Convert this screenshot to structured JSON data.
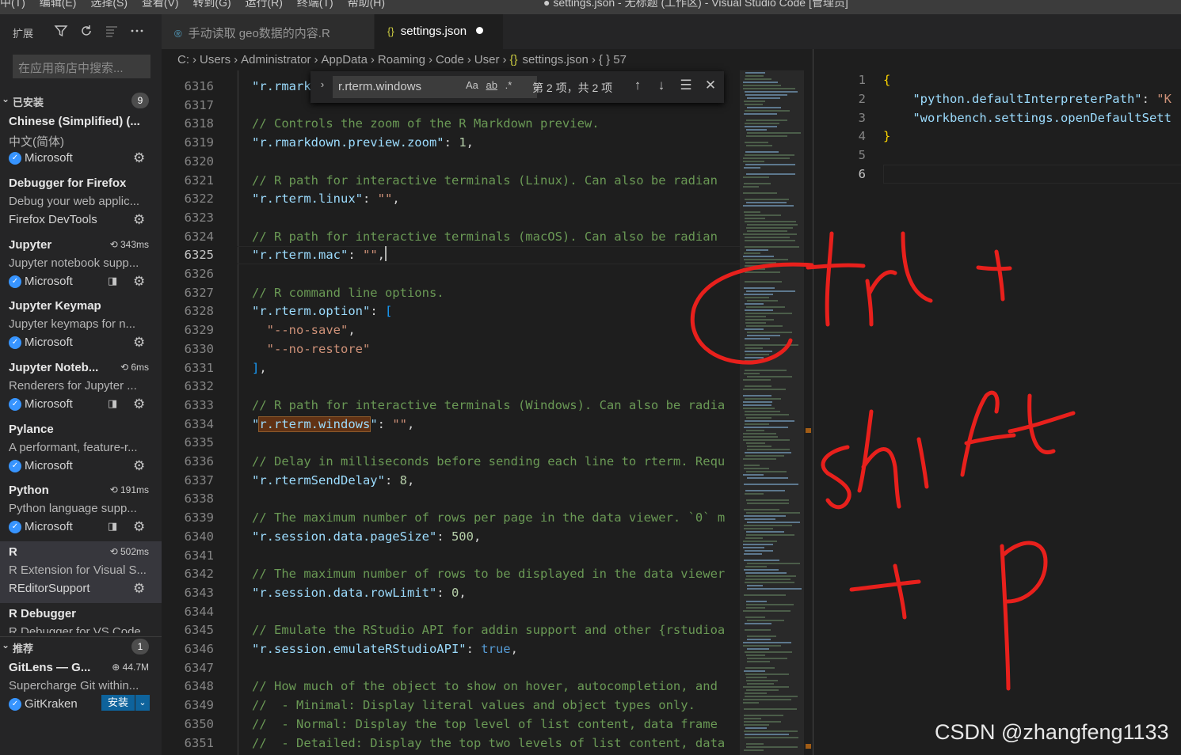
{
  "menubar": {
    "menus": "中(T)  编辑(E)  选择(S)  查看(V)  转到(G)  运行(R)  终端(T)  帮助(H)",
    "window_title": "● settings.json - 无标题 (工作区) - Visual Studio Code [管理员]"
  },
  "sidebar": {
    "title": "扩展",
    "search_placeholder": "在应用商店中搜索...",
    "installed": {
      "label": "已安装",
      "count": "9",
      "items": [
        {
          "name": "Chinese (Simplified) (...",
          "desc": "中文(简体)",
          "publisher": "Microsoft",
          "time": "",
          "remote": false
        },
        {
          "name": "Debugger for Firefox",
          "desc": "Debug your web applic...",
          "publisher": "Firefox DevTools",
          "time": "",
          "remote": false
        },
        {
          "name": "Jupyter",
          "desc": "Jupyter notebook supp...",
          "publisher": "Microsoft",
          "time": "343ms",
          "remote": true
        },
        {
          "name": "Jupyter Keymap",
          "desc": "Jupyter keymaps for n...",
          "publisher": "Microsoft",
          "time": "",
          "remote": false
        },
        {
          "name": "Jupyter Noteb...",
          "desc": "Renderers for Jupyter ...",
          "publisher": "Microsoft",
          "time": "6ms",
          "remote": true
        },
        {
          "name": "Pylance",
          "desc": "A performant, feature-r...",
          "publisher": "Microsoft",
          "time": "",
          "remote": false
        },
        {
          "name": "Python",
          "desc": "Python language supp...",
          "publisher": "Microsoft",
          "time": "191ms",
          "remote": true
        },
        {
          "name": "R",
          "desc": "R Extension for Visual S...",
          "publisher": "REditorSupport",
          "time": "502ms",
          "remote": false
        },
        {
          "name": "R Debugger",
          "desc": "R Debugger for VS Code",
          "publisher": "",
          "time": "",
          "remote": false
        }
      ]
    },
    "recommended": {
      "label": "推荐",
      "count": "1",
      "items": [
        {
          "name": "GitLens — G...",
          "downloads": "44.7M",
          "desc": "Supercharge Git within...",
          "publisher": "GitKraken",
          "install_label": "安装"
        }
      ]
    }
  },
  "tabs": [
    {
      "label": "手动读取 geo数据的内容.R",
      "active": false
    },
    {
      "label": "settings.json",
      "active": true,
      "dirty": true
    }
  ],
  "breadcrumb": [
    "C:",
    "Users",
    "Administrator",
    "AppData",
    "Roaming",
    "Code",
    "User",
    "settings.json",
    "{ } 57"
  ],
  "find_widget": {
    "query": "r.rterm.windows",
    "match_case": "Aa",
    "whole_word": "ab",
    "regex": ".*",
    "result": "第 2 项，共 2 项"
  },
  "editor_left": {
    "active_line": "6325",
    "lines": [
      {
        "n": "6316",
        "parts": [
          [
            "key",
            "\"r.rmark"
          ]
        ]
      },
      {
        "n": "6317",
        "parts": []
      },
      {
        "n": "6318",
        "parts": [
          [
            "cmt",
            "// Controls the zoom of the R Markdown preview."
          ]
        ]
      },
      {
        "n": "6319",
        "parts": [
          [
            "key",
            "\"r.rmarkdown.preview.zoom\""
          ],
          [
            "txt",
            ": "
          ],
          [
            "num",
            "1"
          ],
          [
            "txt",
            ","
          ]
        ]
      },
      {
        "n": "6320",
        "parts": []
      },
      {
        "n": "6321",
        "parts": [
          [
            "cmt",
            "// R path for interactive terminals (Linux). Can also be radian"
          ]
        ]
      },
      {
        "n": "6322",
        "parts": [
          [
            "key",
            "\"r.rterm.linux\""
          ],
          [
            "txt",
            ": "
          ],
          [
            "str",
            "\"\""
          ],
          [
            "txt",
            ","
          ]
        ]
      },
      {
        "n": "6323",
        "parts": []
      },
      {
        "n": "6324",
        "parts": [
          [
            "cmt",
            "// R path for interactive terminals (macOS). Can also be radian"
          ]
        ]
      },
      {
        "n": "6325",
        "parts": [
          [
            "key",
            "\"r.rterm.mac\""
          ],
          [
            "txt",
            ": "
          ],
          [
            "str",
            "\"\""
          ],
          [
            "txt",
            ","
          ],
          [
            "cursor",
            ""
          ]
        ]
      },
      {
        "n": "6326",
        "parts": []
      },
      {
        "n": "6327",
        "parts": [
          [
            "cmt",
            "// R command line options."
          ]
        ]
      },
      {
        "n": "6328",
        "parts": [
          [
            "key",
            "\"r.rterm.option\""
          ],
          [
            "txt",
            ": "
          ],
          [
            "brk",
            "["
          ]
        ]
      },
      {
        "n": "6329",
        "parts": [
          [
            "txt",
            "  "
          ],
          [
            "str",
            "\"--no-save\""
          ],
          [
            "txt",
            ","
          ]
        ]
      },
      {
        "n": "6330",
        "parts": [
          [
            "txt",
            "  "
          ],
          [
            "str",
            "\"--no-restore\""
          ]
        ]
      },
      {
        "n": "6331",
        "parts": [
          [
            "brk",
            "]"
          ],
          [
            "txt",
            ","
          ]
        ]
      },
      {
        "n": "6332",
        "parts": []
      },
      {
        "n": "6333",
        "parts": [
          [
            "cmt",
            "// R path for interactive terminals (Windows). Can also be radia"
          ]
        ]
      },
      {
        "n": "6334",
        "parts": [
          [
            "key",
            "\""
          ],
          [
            "match",
            "r.rterm.windows"
          ],
          [
            "key",
            "\""
          ],
          [
            "txt",
            ": "
          ],
          [
            "str",
            "\"\""
          ],
          [
            "txt",
            ","
          ]
        ]
      },
      {
        "n": "6335",
        "parts": []
      },
      {
        "n": "6336",
        "parts": [
          [
            "cmt",
            "// Delay in milliseconds before sending each line to rterm. Requ"
          ]
        ]
      },
      {
        "n": "6337",
        "parts": [
          [
            "key",
            "\"r.rtermSendDelay\""
          ],
          [
            "txt",
            ": "
          ],
          [
            "num",
            "8"
          ],
          [
            "txt",
            ","
          ]
        ]
      },
      {
        "n": "6338",
        "parts": []
      },
      {
        "n": "6339",
        "parts": [
          [
            "cmt",
            "// The maximum number of rows per page in the data viewer. `0` m"
          ]
        ]
      },
      {
        "n": "6340",
        "parts": [
          [
            "key",
            "\"r.session.data.pageSize\""
          ],
          [
            "txt",
            ": "
          ],
          [
            "num",
            "500"
          ],
          [
            "txt",
            ","
          ]
        ]
      },
      {
        "n": "6341",
        "parts": []
      },
      {
        "n": "6342",
        "parts": [
          [
            "cmt",
            "// The maximum number of rows to be displayed in the data viewer"
          ]
        ]
      },
      {
        "n": "6343",
        "parts": [
          [
            "key",
            "\"r.session.data.rowLimit\""
          ],
          [
            "txt",
            ": "
          ],
          [
            "num",
            "0"
          ],
          [
            "txt",
            ","
          ]
        ]
      },
      {
        "n": "6344",
        "parts": []
      },
      {
        "n": "6345",
        "parts": [
          [
            "cmt",
            "// Emulate the RStudio API for addin support and other {rstudioa"
          ]
        ]
      },
      {
        "n": "6346",
        "parts": [
          [
            "key",
            "\"r.session.emulateRStudioAPI\""
          ],
          [
            "txt",
            ": "
          ],
          [
            "kw",
            "true"
          ],
          [
            "txt",
            ","
          ]
        ]
      },
      {
        "n": "6347",
        "parts": []
      },
      {
        "n": "6348",
        "parts": [
          [
            "cmt",
            "// How much of the object to show on hover, autocompletion, and"
          ]
        ]
      },
      {
        "n": "6349",
        "parts": [
          [
            "cmt",
            "//  - Minimal: Display literal values and object types only."
          ]
        ]
      },
      {
        "n": "6350",
        "parts": [
          [
            "cmt",
            "//  - Normal: Display the top level of list content, data frame"
          ]
        ]
      },
      {
        "n": "6351",
        "parts": [
          [
            "cmt",
            "//  - Detailed: Display the top two levels of list content, data"
          ]
        ]
      }
    ]
  },
  "editor_right": {
    "active_line": "6",
    "lines": [
      {
        "n": "1",
        "parts": [
          [
            "brace",
            "{"
          ]
        ]
      },
      {
        "n": "2",
        "parts": [
          [
            "txt",
            "    "
          ],
          [
            "key",
            "\"python.defaultInterpreterPath\""
          ],
          [
            "txt",
            ": "
          ],
          [
            "str",
            "\"K"
          ]
        ]
      },
      {
        "n": "3",
        "parts": [
          [
            "txt",
            "    "
          ],
          [
            "key",
            "\"workbench.settings.openDefaultSett"
          ]
        ]
      },
      {
        "n": "4",
        "parts": [
          [
            "brace",
            "}"
          ]
        ]
      },
      {
        "n": "5",
        "parts": []
      },
      {
        "n": "6",
        "parts": []
      }
    ]
  },
  "annotation": {
    "handwriting": "ctrl + shift + p",
    "color": "#e8201c"
  },
  "watermark": "CSDN @zhangfeng1133",
  "colors": {
    "editor_bg": "#1e1e1e",
    "sidebar_bg": "#252526",
    "comment": "#6a9955",
    "key": "#9cdcfe",
    "string": "#ce9178",
    "number": "#b5cea8",
    "keyword": "#569cd6"
  }
}
